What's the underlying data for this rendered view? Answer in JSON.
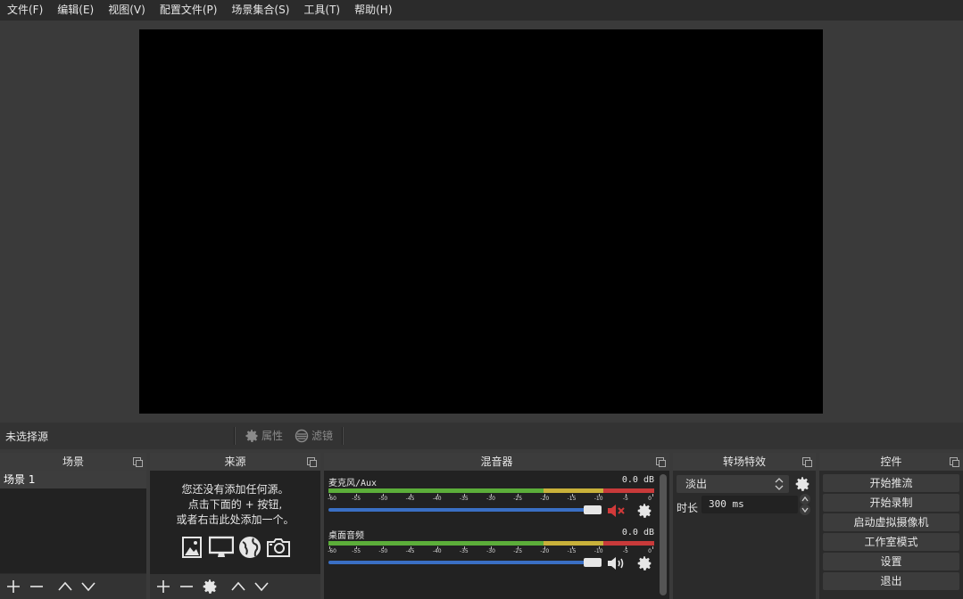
{
  "menu": [
    "文件(F)",
    "编辑(E)",
    "视图(V)",
    "配置文件(P)",
    "场景集合(S)",
    "工具(T)",
    "帮助(H)"
  ],
  "source_toolbar": {
    "selection": "未选择源",
    "properties": "属性",
    "filters": "滤镜"
  },
  "scenes": {
    "title": "场景",
    "items": [
      "场景 1"
    ]
  },
  "sources": {
    "title": "来源",
    "hint_lines": [
      "您还没有添加任何源。",
      "点击下面的 + 按钮,",
      "或者右击此处添加一个。"
    ]
  },
  "mixer": {
    "title": "混音器",
    "scale": [
      "-60",
      "-55",
      "-50",
      "-45",
      "-40",
      "-35",
      "-30",
      "-25",
      "-20",
      "-15",
      "-10",
      "-5",
      "0"
    ],
    "channels": [
      {
        "name": "麦克风/Aux",
        "db": "0.0 dB",
        "muted": true,
        "volume": 1.0
      },
      {
        "name": "桌面音频",
        "db": "0.0 dB",
        "muted": false,
        "volume": 1.0
      }
    ]
  },
  "transitions": {
    "title": "转场特效",
    "selected": "淡出",
    "duration_label": "时长",
    "duration_value": "300 ms"
  },
  "controls": {
    "title": "控件",
    "buttons": [
      "开始推流",
      "开始录制",
      "启动虚拟摄像机",
      "工作室模式",
      "设置",
      "退出"
    ]
  },
  "colors": {
    "meter_green": "#5cae3a",
    "meter_yellow": "#c9b13a",
    "meter_red": "#c83a3a",
    "slider_blue": "#3a6fc4",
    "mute_red": "#d23a3a"
  }
}
